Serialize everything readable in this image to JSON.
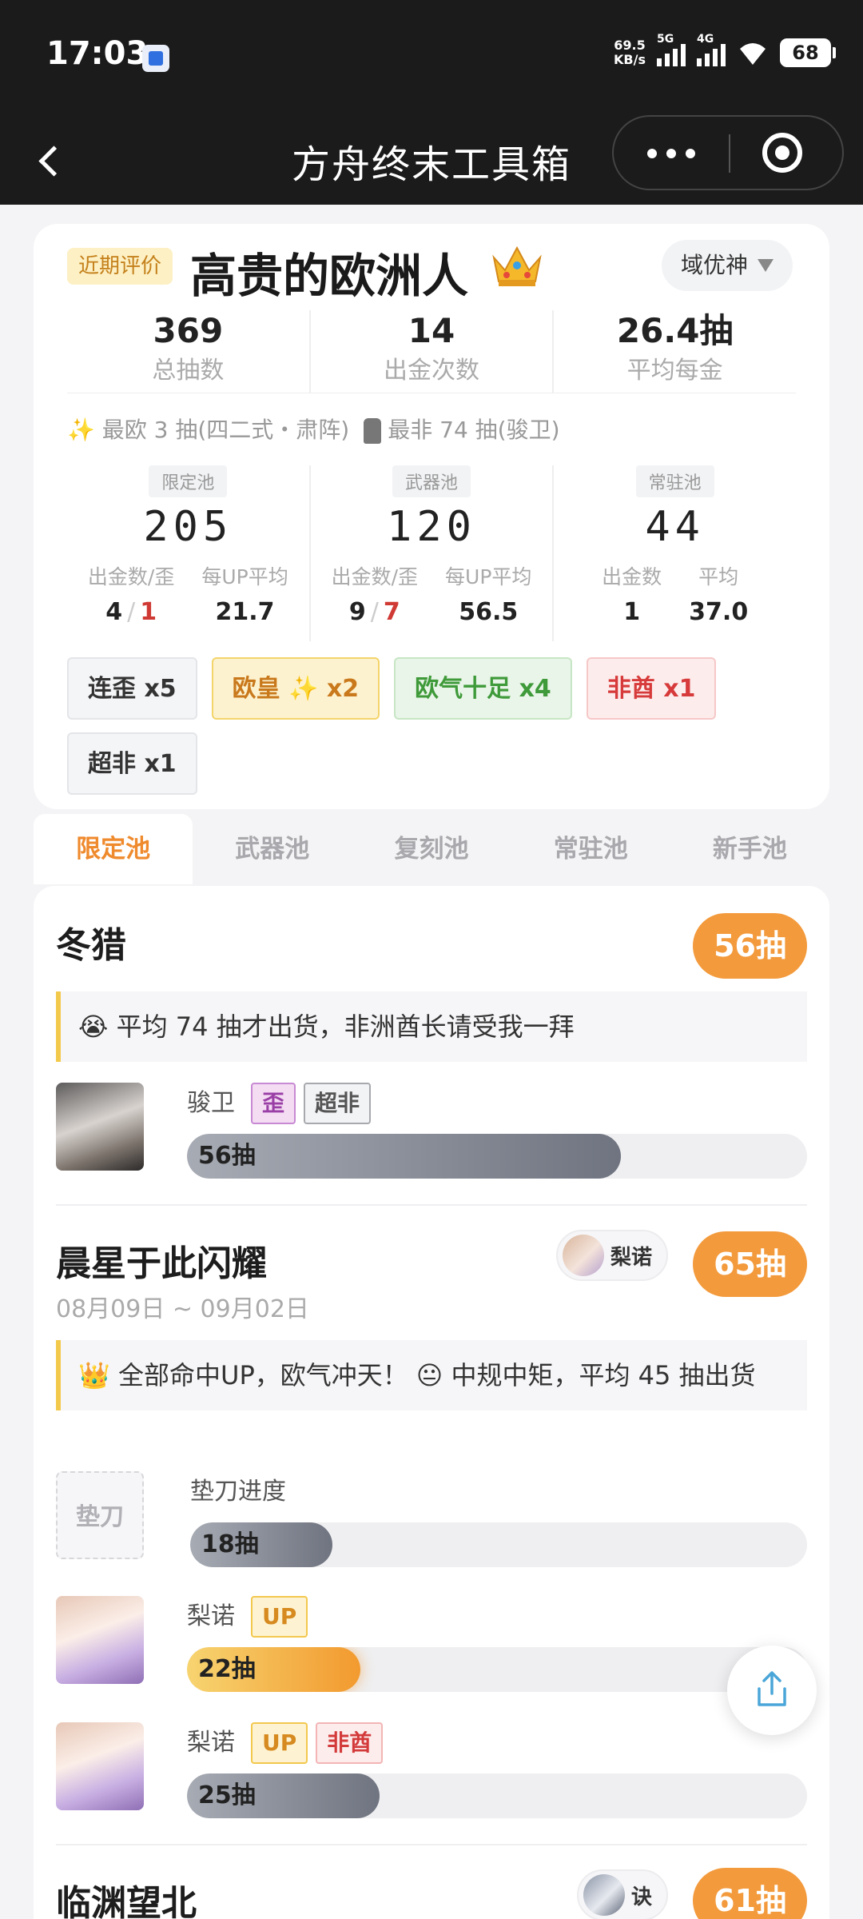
{
  "status_bar": {
    "time": "17:03",
    "speed": "69.5",
    "speed_unit": "KB/s",
    "net1": "5G",
    "net2": "4G",
    "battery": "68"
  },
  "titlebar": {
    "title": "方舟终末工具箱"
  },
  "summary": {
    "recent_label": "近期评价",
    "verdict": "高贵的欧洲人",
    "server": "域优神",
    "stats": [
      {
        "value": "369",
        "label": "总抽数"
      },
      {
        "value": "14",
        "label": "出金次数"
      },
      {
        "value": "26.4抽",
        "label": "平均每金"
      }
    ],
    "best": "✨ 最欧 3 抽(四二式・肃阵)",
    "worst": "最非 74 抽(骏卫)",
    "pools": [
      {
        "label": "限定池",
        "count": "205",
        "k1": "出金数/歪",
        "v1a": "4",
        "v1b": "1",
        "k2": "每UP平均",
        "v2": "21.7"
      },
      {
        "label": "武器池",
        "count": "120",
        "k1": "出金数/歪",
        "v1a": "9",
        "v1b": "7",
        "k2": "每UP平均",
        "v2": "56.5"
      },
      {
        "label": "常驻池",
        "count": "44",
        "k1": "出金数",
        "v1a": "1",
        "k2": "平均",
        "v2": "37.0"
      }
    ],
    "tags": [
      "连歪 x5",
      "欧皇 ✨ x2",
      "欧气十足 x4",
      "非酋 x1",
      "超非 x1"
    ]
  },
  "tabs": [
    "限定池",
    "武器池",
    "复刻池",
    "常驻池",
    "新手池"
  ],
  "banners": [
    {
      "name": "冬猎",
      "count": "56抽",
      "quote": "😭 平均 74 抽才出货，非洲酋长请受我一拜",
      "pulls": [
        {
          "name": "骏卫",
          "tags": [
            "歪",
            "超非"
          ],
          "bar": "56抽",
          "fill": 0.7
        }
      ]
    },
    {
      "name": "晨星于此闪耀",
      "count": "65抽",
      "date": "08月09日 ~ 09月02日",
      "chip": "梨诺",
      "quote": "👑 全部命中UP，欧气冲天！ 😐 中规中矩，平均 45 抽出货",
      "pad_label": "垫刀",
      "pad_title": "垫刀进度",
      "pad_bar": "18抽",
      "pad_fill": 0.23,
      "pulls": [
        {
          "name": "梨诺",
          "tags": [
            "UP"
          ],
          "bar": "22抽",
          "fill": 0.28
        },
        {
          "name": "梨诺",
          "tags": [
            "UP",
            "非酋"
          ],
          "bar": "25抽",
          "fill": 0.31
        }
      ]
    },
    {
      "name": "临渊望北",
      "count": "61抽",
      "chip": "诀"
    }
  ],
  "colors": {
    "accent": "#f39a3c",
    "tab_active": "#ef8a2d",
    "verdict_badge": "#fdf0c4"
  }
}
